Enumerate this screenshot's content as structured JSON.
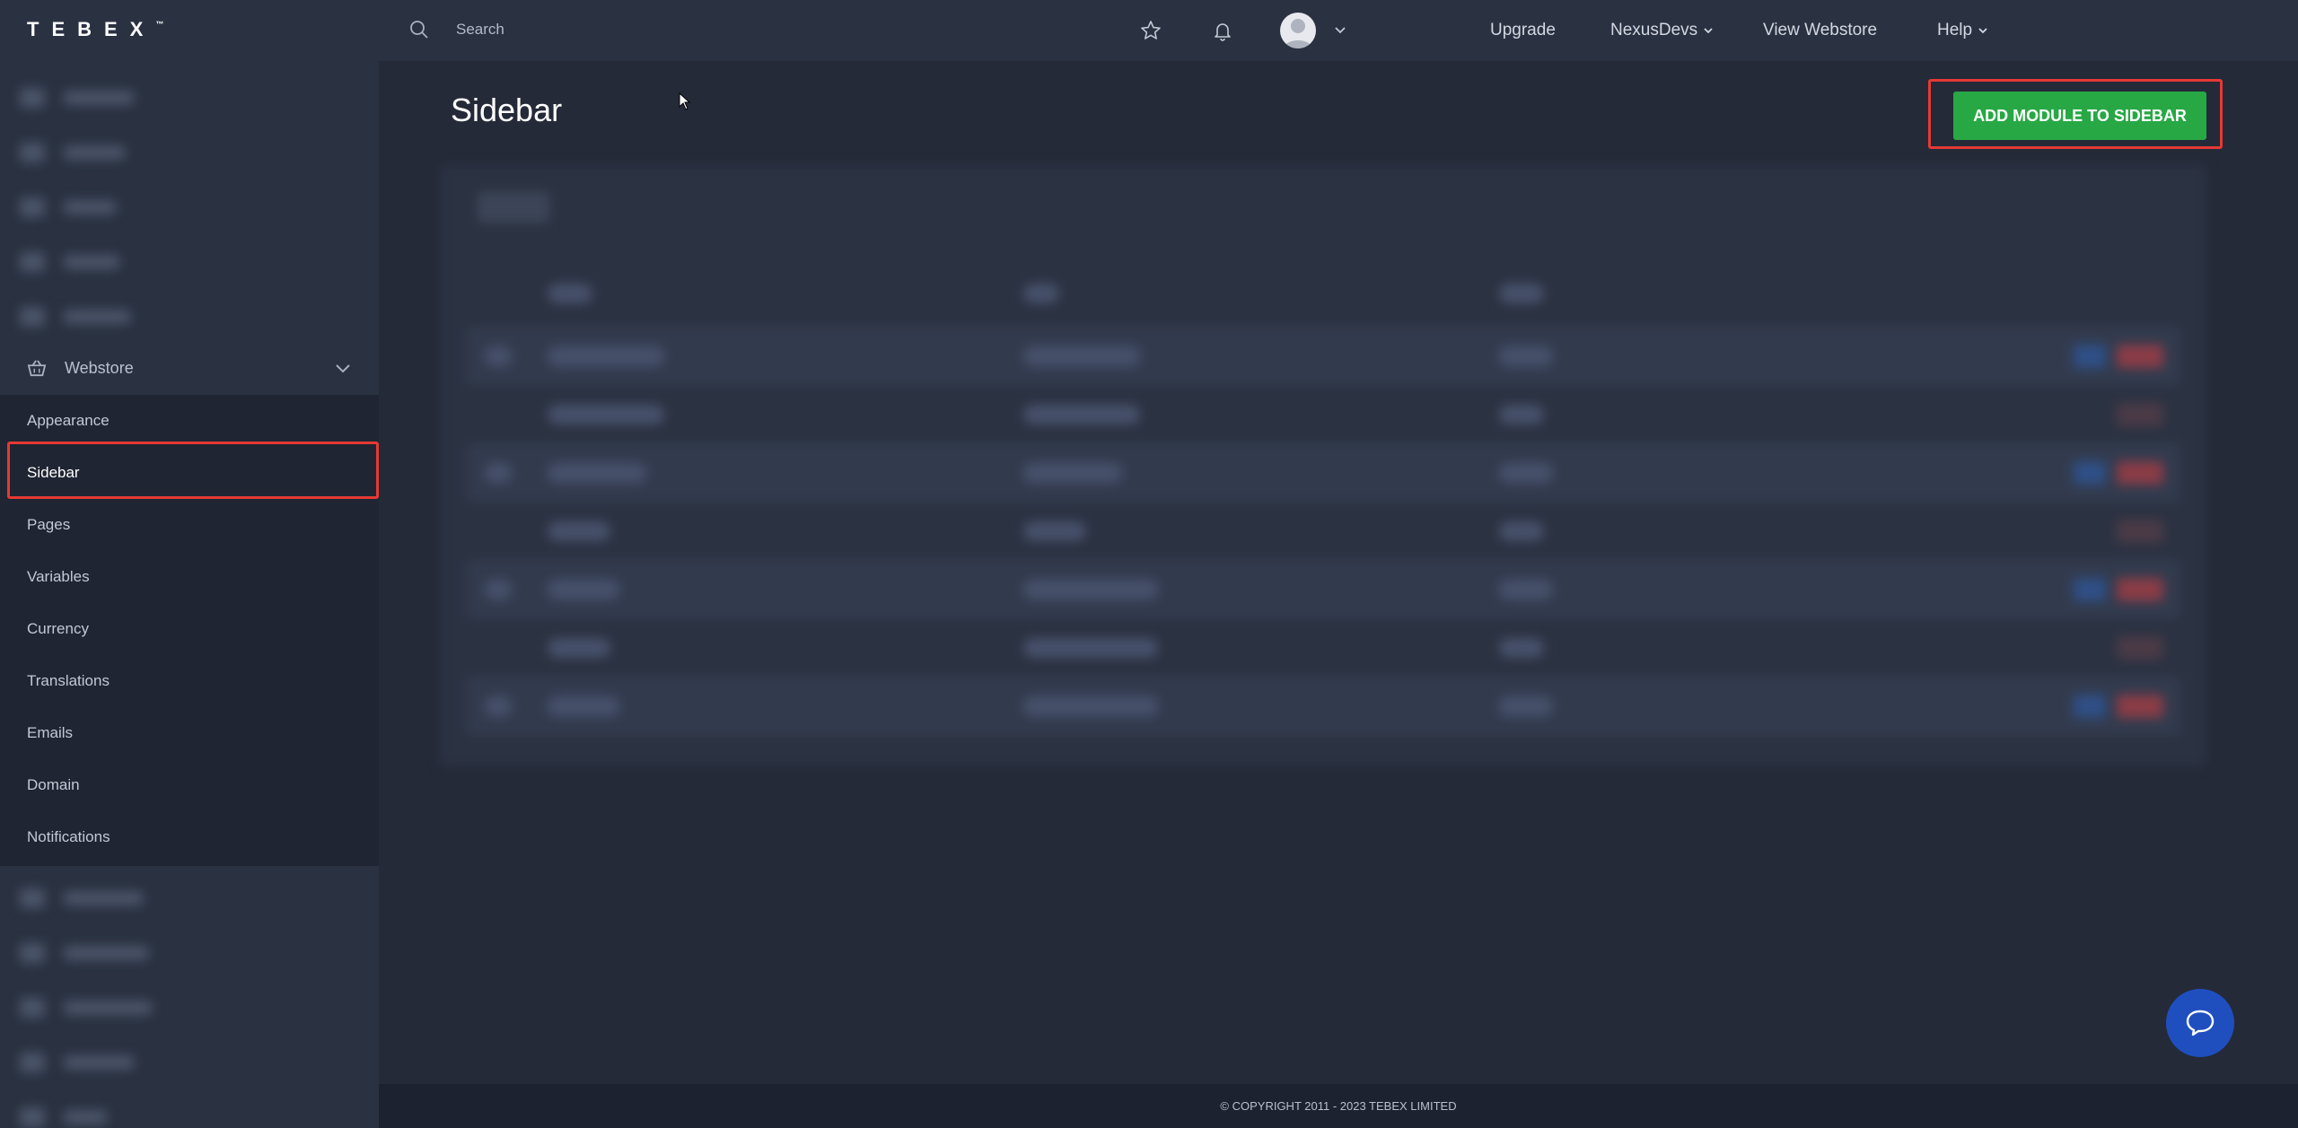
{
  "app": {
    "logo_text": "TEBEX",
    "logo_tm": "™"
  },
  "sidebar": {
    "section_label": "Webstore",
    "items": [
      {
        "label": "Appearance",
        "active": false
      },
      {
        "label": "Sidebar",
        "active": true
      },
      {
        "label": "Pages",
        "active": false
      },
      {
        "label": "Variables",
        "active": false
      },
      {
        "label": "Currency",
        "active": false
      },
      {
        "label": "Translations",
        "active": false
      },
      {
        "label": "Emails",
        "active": false
      },
      {
        "label": "Domain",
        "active": false
      },
      {
        "label": "Notifications",
        "active": false
      }
    ]
  },
  "topbar": {
    "search_placeholder": "Search",
    "upgrade": "Upgrade",
    "account": "NexusDevs",
    "view_webstore": "View Webstore",
    "help": "Help"
  },
  "main": {
    "title": "Sidebar",
    "add_button": "ADD MODULE TO SIDEBAR"
  },
  "footer": {
    "copyright": "© COPYRIGHT 2011 - 2023 TEBEX LIMITED"
  },
  "colors": {
    "accent_green": "#27a844",
    "highlight_red": "#e53935",
    "chat_blue": "#1f4fbf",
    "sidebar_bg": "#2a3242",
    "main_bg": "#242a38"
  }
}
